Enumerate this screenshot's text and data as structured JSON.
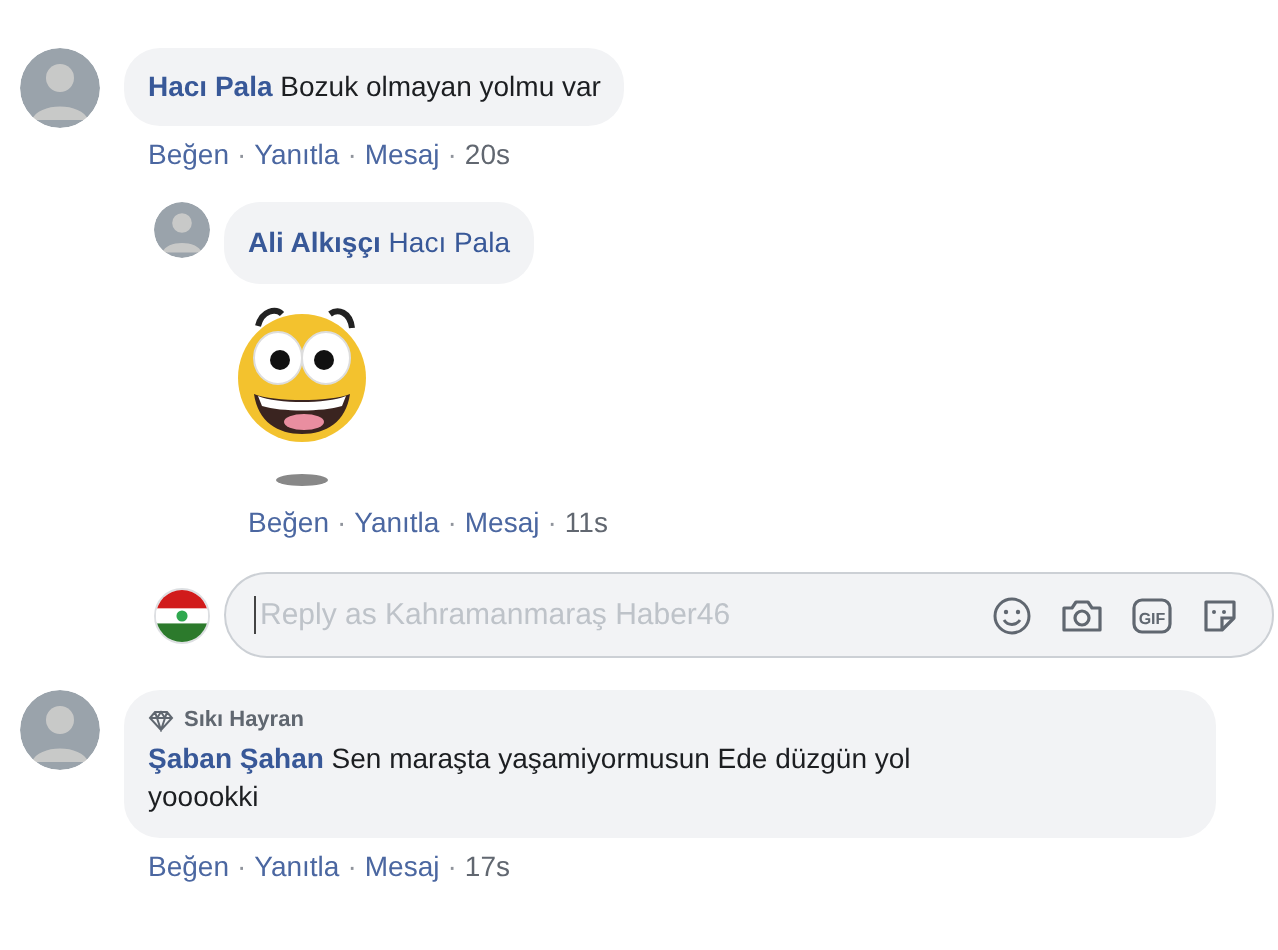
{
  "separator": "·",
  "comments": [
    {
      "author": "Hacı Pala",
      "text": "Bozuk olmayan yolmu var",
      "actions": [
        "Beğen",
        "Yanıtla",
        "Mesaj"
      ],
      "time": "20s",
      "replies": [
        {
          "author": "Ali Alkışçı",
          "mention": "Hacı Pala",
          "sticker": true,
          "actions": [
            "Beğen",
            "Yanıtla",
            "Mesaj"
          ],
          "time": "11s"
        }
      ],
      "reply_box": {
        "placeholder": "Reply as Kahramanmaraş Haber46",
        "tools": [
          {
            "kind": "emoji"
          },
          {
            "kind": "camera"
          },
          {
            "kind": "gif",
            "label": "GIF"
          },
          {
            "kind": "sticker"
          }
        ]
      }
    },
    {
      "badge": "Sıkı Hayran",
      "author": "Şaban Şahan",
      "text": "Sen maraşta yaşamiyormusun Ede düzgün yol yooookki",
      "actions": [
        "Beğen",
        "Yanıtla",
        "Mesaj"
      ],
      "time": "17s"
    }
  ]
}
